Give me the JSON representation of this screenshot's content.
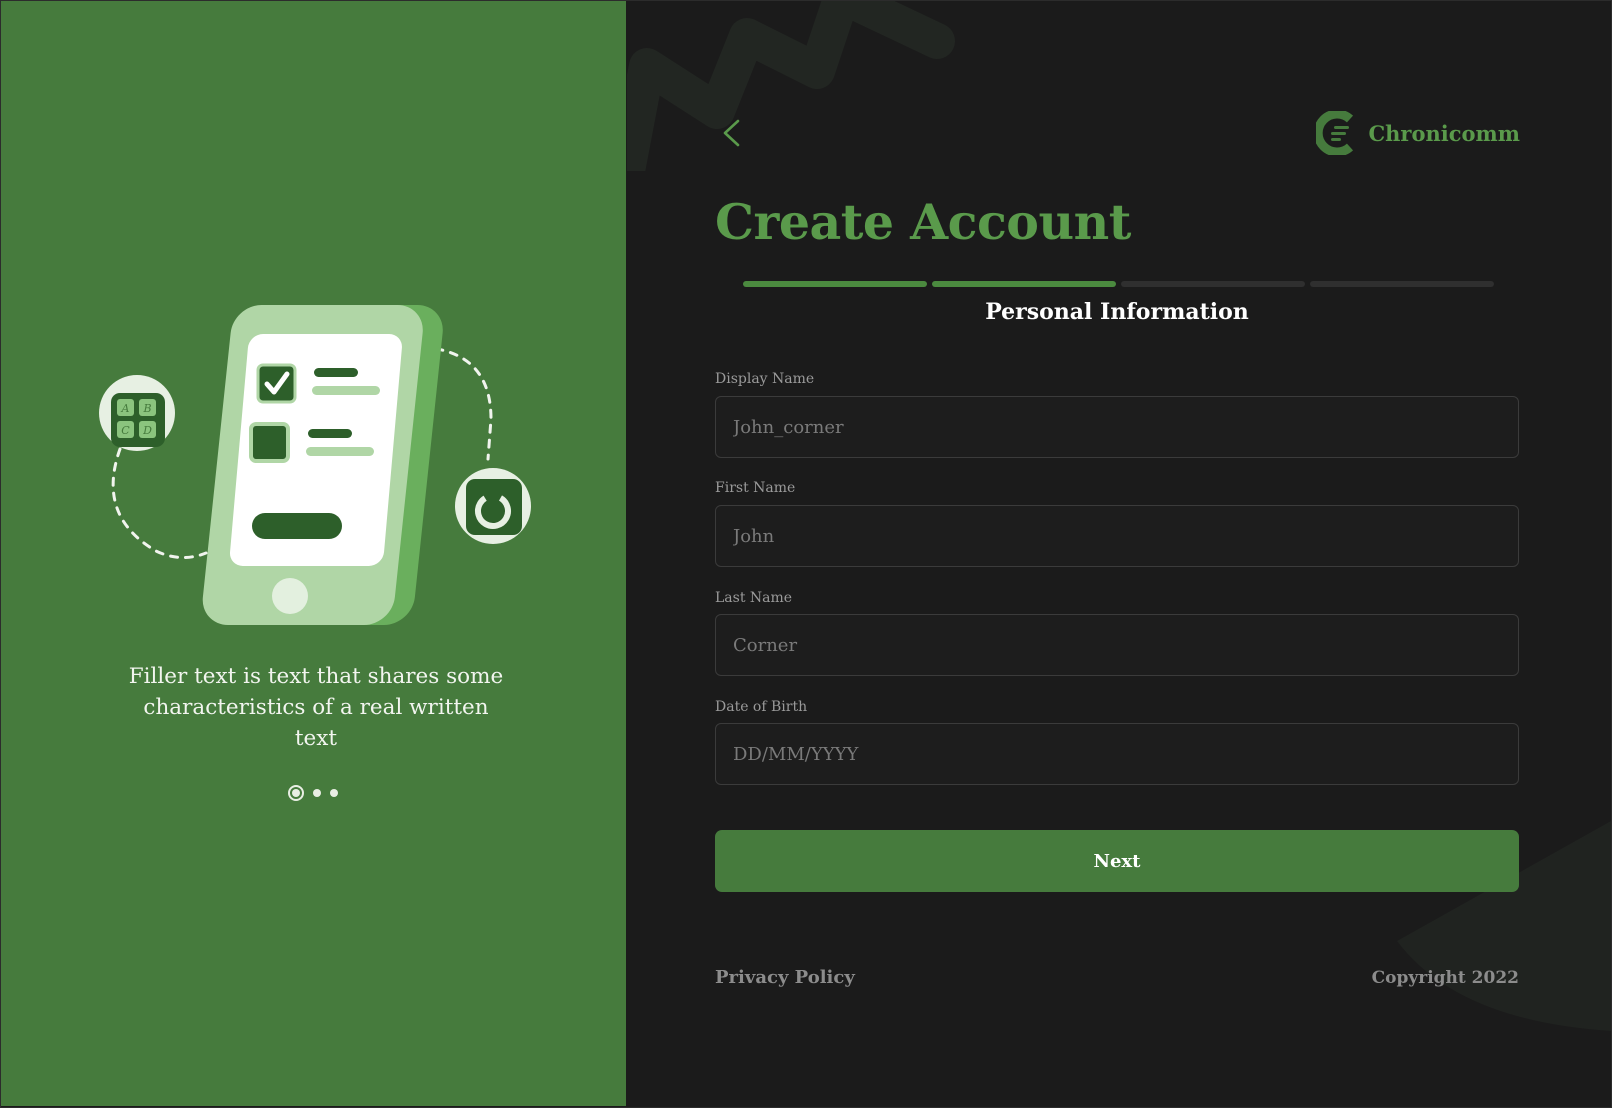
{
  "sidebar": {
    "caption": "Filler text is text that shares some characteristics of a real written text",
    "carousel": {
      "total": 3,
      "active_index": 0
    },
    "tile_letters": [
      "A",
      "B",
      "C",
      "D"
    ]
  },
  "header": {
    "back_icon": "chevron-left-icon",
    "brand_name": "Chronicomm",
    "brand_logo": "chronicomm-logo"
  },
  "form": {
    "title": "Create Account",
    "progress": {
      "total_steps": 4,
      "completed_steps": 2
    },
    "section_title": "Personal Information",
    "fields": [
      {
        "label": "Display Name",
        "placeholder": "John_corner",
        "value": ""
      },
      {
        "label": "First Name",
        "placeholder": "John",
        "value": ""
      },
      {
        "label": "Last Name",
        "placeholder": "Corner",
        "value": ""
      },
      {
        "label": "Date of Birth",
        "placeholder": "DD/MM/YYYY",
        "value": ""
      }
    ],
    "submit_label": "Next"
  },
  "footer": {
    "privacy_label": "Privacy Policy",
    "copyright": "Copyright 2022"
  },
  "colors": {
    "accent": "#467b3d",
    "accent_text": "#5a9a4b",
    "background_dark": "#1b1b1b",
    "progress_inactive": "#2f2f2f"
  }
}
